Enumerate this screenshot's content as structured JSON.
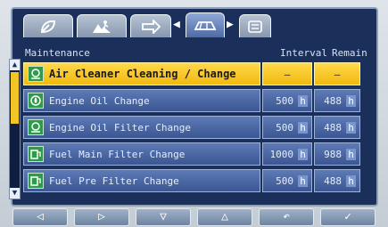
{
  "tabs": [
    {
      "icon": "leaf-icon"
    },
    {
      "icon": "person-icon"
    },
    {
      "icon": "arrow-tab-icon"
    },
    {
      "icon": "machine-icon",
      "active": true
    },
    {
      "icon": "list-icon"
    }
  ],
  "tab_arrows": {
    "left": "◀",
    "right": "▶"
  },
  "header": {
    "title": "Maintenance",
    "interval": "Interval",
    "remain": "Remain"
  },
  "scrollbar": {
    "up": "▲",
    "down": "▼"
  },
  "rows": [
    {
      "name": "Air Cleaner Cleaning / Change",
      "interval": "—",
      "remain": "—",
      "icon": "air-filter-icon",
      "selected": true
    },
    {
      "name": "Engine Oil Change",
      "interval": "500",
      "remain": "488",
      "unit": "h",
      "icon": "oil-drop-icon"
    },
    {
      "name": "Engine Oil Filter Change",
      "interval": "500",
      "remain": "488",
      "unit": "h",
      "icon": "oil-filter-icon"
    },
    {
      "name": "Fuel Main Filter Change",
      "interval": "1000",
      "remain": "988",
      "unit": "h",
      "icon": "fuel-pump-icon"
    },
    {
      "name": "Fuel Pre Filter Change",
      "interval": "500",
      "remain": "488",
      "unit": "h",
      "icon": "fuel-pump-icon"
    }
  ],
  "softkeys": [
    {
      "label": "◁",
      "icon": "left-arrow-icon"
    },
    {
      "label": "▷",
      "icon": "right-arrow-icon"
    },
    {
      "label": "▽",
      "icon": "down-arrow-icon"
    },
    {
      "label": "△",
      "icon": "up-arrow-icon"
    },
    {
      "label": "↶",
      "icon": "return-icon"
    },
    {
      "label": "✓",
      "icon": "checkmark-icon"
    }
  ],
  "colors": {
    "selected": "#f2c425",
    "row": "#4a67a4",
    "background": "#1b2f5b"
  }
}
